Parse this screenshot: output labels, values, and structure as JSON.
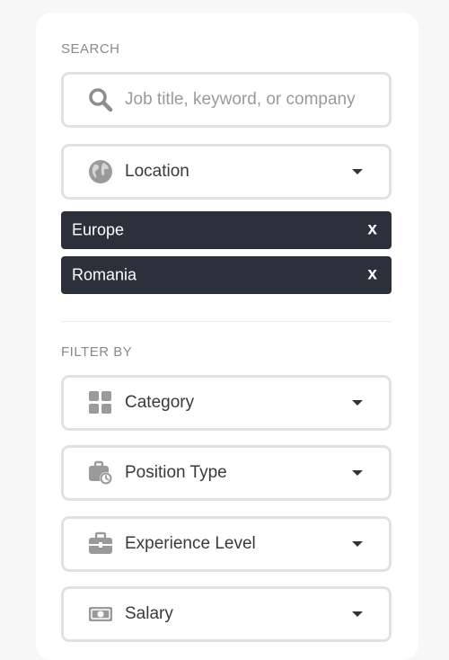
{
  "search": {
    "section_title": "SEARCH",
    "placeholder": "Job title, keyword, or company",
    "value": ""
  },
  "location": {
    "label": "Location",
    "icon": "globe-icon"
  },
  "selected_locations": [
    {
      "label": "Europe",
      "remove": "x"
    },
    {
      "label": "Romania",
      "remove": "x"
    }
  ],
  "filters": {
    "section_title": "FILTER BY",
    "items": [
      {
        "label": "Category",
        "icon": "grid-icon"
      },
      {
        "label": "Position Type",
        "icon": "briefcase-clock-icon"
      },
      {
        "label": "Experience Level",
        "icon": "briefcase-icon"
      },
      {
        "label": "Salary",
        "icon": "money-icon"
      }
    ]
  },
  "colors": {
    "tag_background": "#2b303a",
    "icon": "#9a9a9a",
    "border": "#e1e1e1"
  }
}
